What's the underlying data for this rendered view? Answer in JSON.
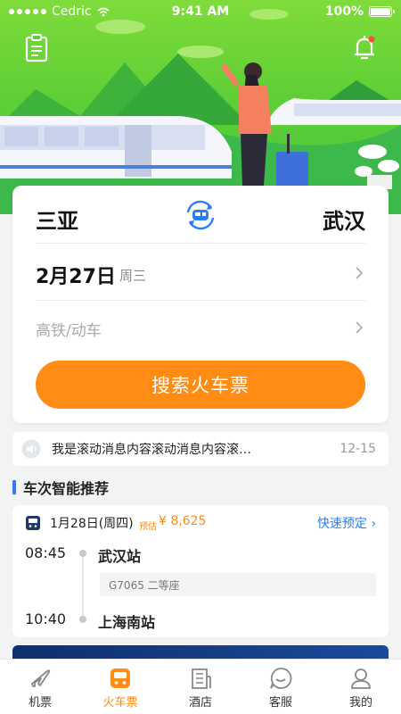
{
  "status_bar": {
    "carrier": "Cedric",
    "time": "9:41 AM",
    "battery": "100%"
  },
  "search": {
    "from_city": "三亚",
    "to_city": "武汉",
    "date": "2月27日",
    "weekday": "周三",
    "train_type_placeholder": "高铁/动车",
    "search_button": "搜索火车票"
  },
  "notice": {
    "text": "我是滚动消息内容滚动消息内容滚…",
    "date": "12-15"
  },
  "section": {
    "title": "车次智能推荐"
  },
  "recommendation": {
    "date": "1月28日(周四)",
    "estimate_label": "预估",
    "price": "¥ 8,625",
    "quick_book": "快速预定 ›",
    "depart_time": "08:45",
    "depart_station": "武汉站",
    "train_info": "G7065 二等座",
    "arrive_time": "10:40",
    "arrive_station": "上海南站"
  },
  "tabs": [
    {
      "label": "机票",
      "icon": "plane-icon",
      "active": false
    },
    {
      "label": "火车票",
      "icon": "train-icon",
      "active": true
    },
    {
      "label": "酒店",
      "icon": "hotel-icon",
      "active": false
    },
    {
      "label": "客服",
      "icon": "chat-icon",
      "active": false
    },
    {
      "label": "我的",
      "icon": "user-icon",
      "active": false
    }
  ],
  "colors": {
    "accent": "#ff8c14",
    "primary_blue": "#2b7df6",
    "hero_green": "#5fcf35"
  }
}
